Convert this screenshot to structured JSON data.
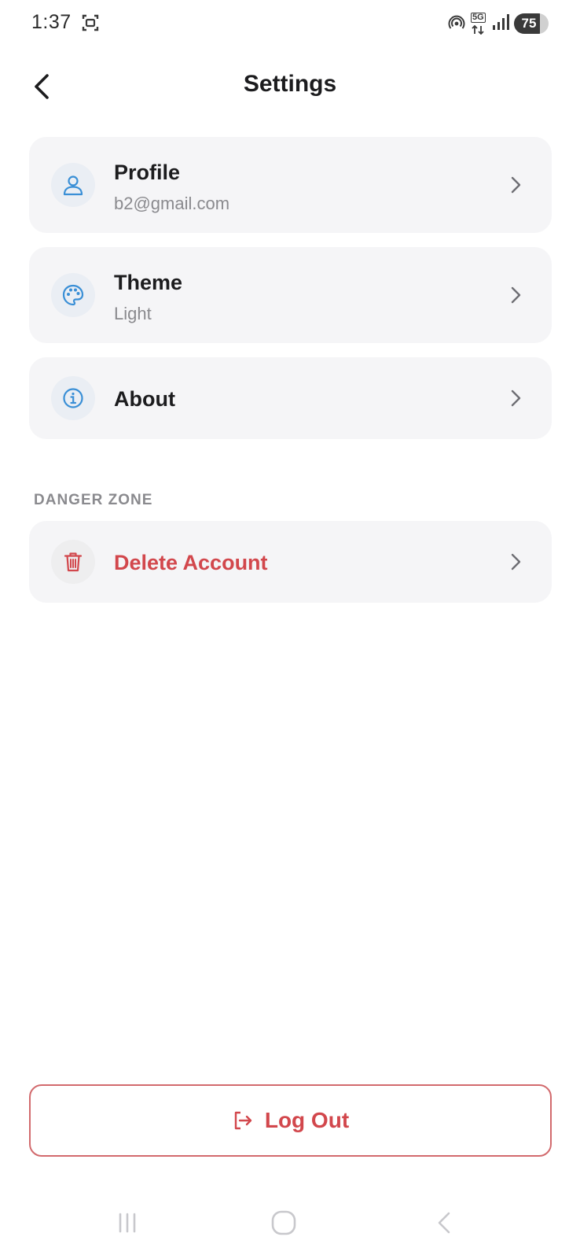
{
  "status_bar": {
    "time": "1:37",
    "network": "5G",
    "battery_level": "75",
    "battery_fraction": 0.75
  },
  "header": {
    "title": "Settings",
    "back_icon": "chevron-left-icon"
  },
  "settings_items": [
    {
      "title": "Profile",
      "subtitle": "b2@gmail.com",
      "icon": "user-icon"
    },
    {
      "title": "Theme",
      "subtitle": "Light",
      "icon": "palette-icon"
    },
    {
      "title": "About",
      "icon": "info-icon"
    }
  ],
  "danger_zone": {
    "label": "DANGER ZONE",
    "items": [
      {
        "title": "Delete Account",
        "icon": "trash-icon"
      }
    ]
  },
  "logout": {
    "label": "Log Out",
    "icon": "logout-icon"
  },
  "colors": {
    "accent_blue": "#3a8fd6",
    "danger_red": "#d2474c",
    "card_bg": "#f5f5f7",
    "icon_bg": "#eaeef4"
  }
}
